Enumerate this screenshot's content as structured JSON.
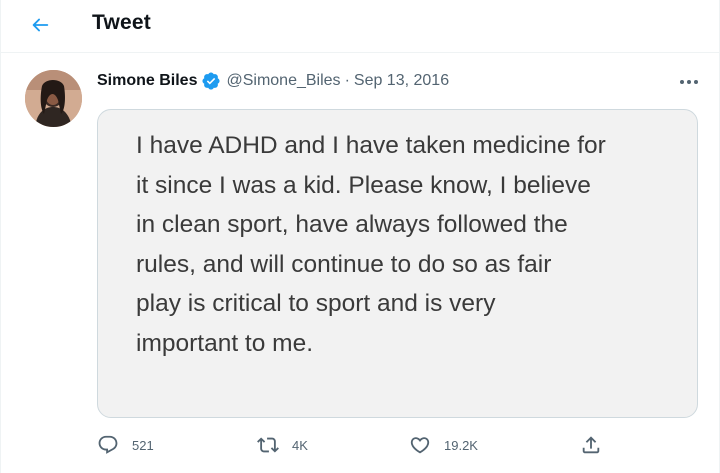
{
  "header": {
    "title": "Tweet",
    "back_icon": "arrow-left-icon",
    "accent": "#1d9bf0"
  },
  "tweet": {
    "author_name": "Simone Biles",
    "verified_icon": "verified-badge-icon",
    "handle": "@Simone_Biles",
    "separator": "·",
    "date": "Sep 13, 2016",
    "more_icon": "more-options-icon",
    "image_text": "I have ADHD and I have taken medicine for\nit since I was a kid. Please know, I believe\nin clean sport, have always followed the\nrules, and will continue to do so as fair\nplay is critical to sport and is very\nimportant to me.",
    "actions": {
      "reply": {
        "icon": "reply-icon",
        "count": "521"
      },
      "retweet": {
        "icon": "retweet-icon",
        "count": "4K"
      },
      "like": {
        "icon": "heart-icon",
        "count": "19.2K"
      },
      "share": {
        "icon": "share-icon"
      }
    }
  }
}
